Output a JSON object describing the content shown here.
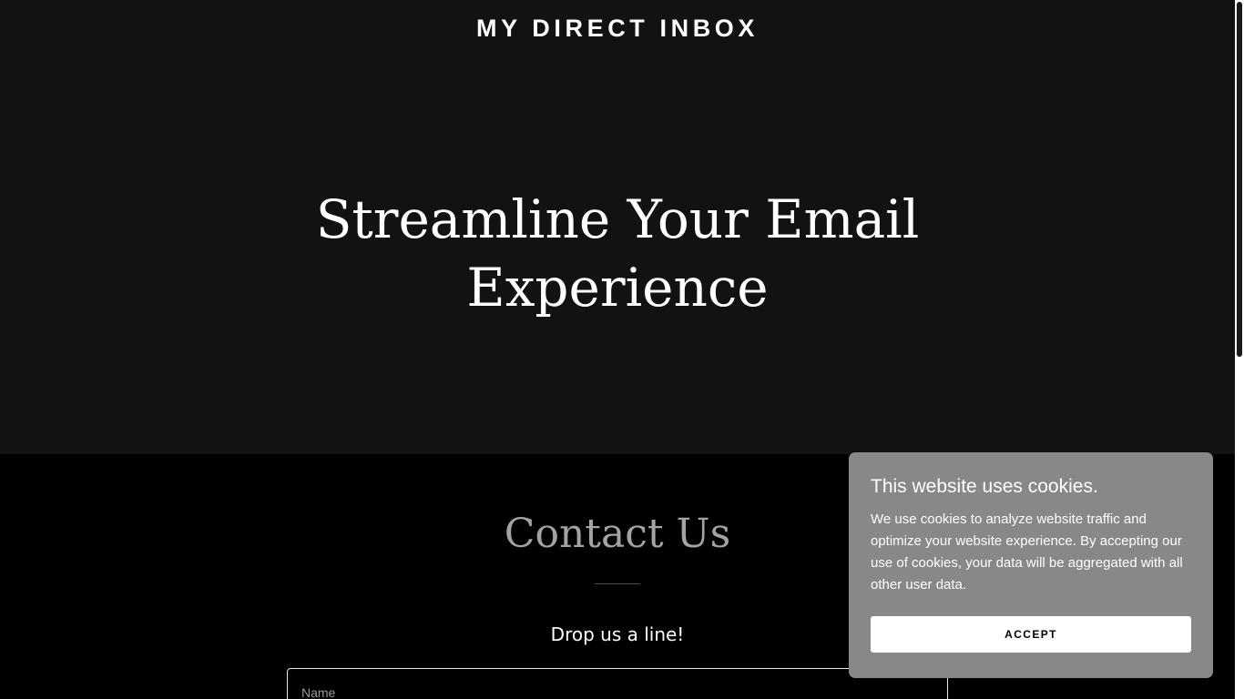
{
  "header": {
    "site_title": "MY DIRECT INBOX",
    "hero_heading_line1": "Streamline Your Email",
    "hero_heading_line2": "Experience"
  },
  "contact": {
    "heading": "Contact Us",
    "tagline": "Drop us a line!",
    "name_field_label": "Name"
  },
  "cookie_banner": {
    "title": "This website uses cookies.",
    "text": "We use cookies to analyze website traffic and optimize your website experience. By accepting our use of cookies, your data will be aggregated with all other user data.",
    "accept_label": "ACCEPT"
  },
  "colors": {
    "hero_background": "#121212",
    "page_background": "#000000",
    "cookie_background": "#888888",
    "contact_heading": "#a3a3a3",
    "text_primary": "#ffffff"
  }
}
